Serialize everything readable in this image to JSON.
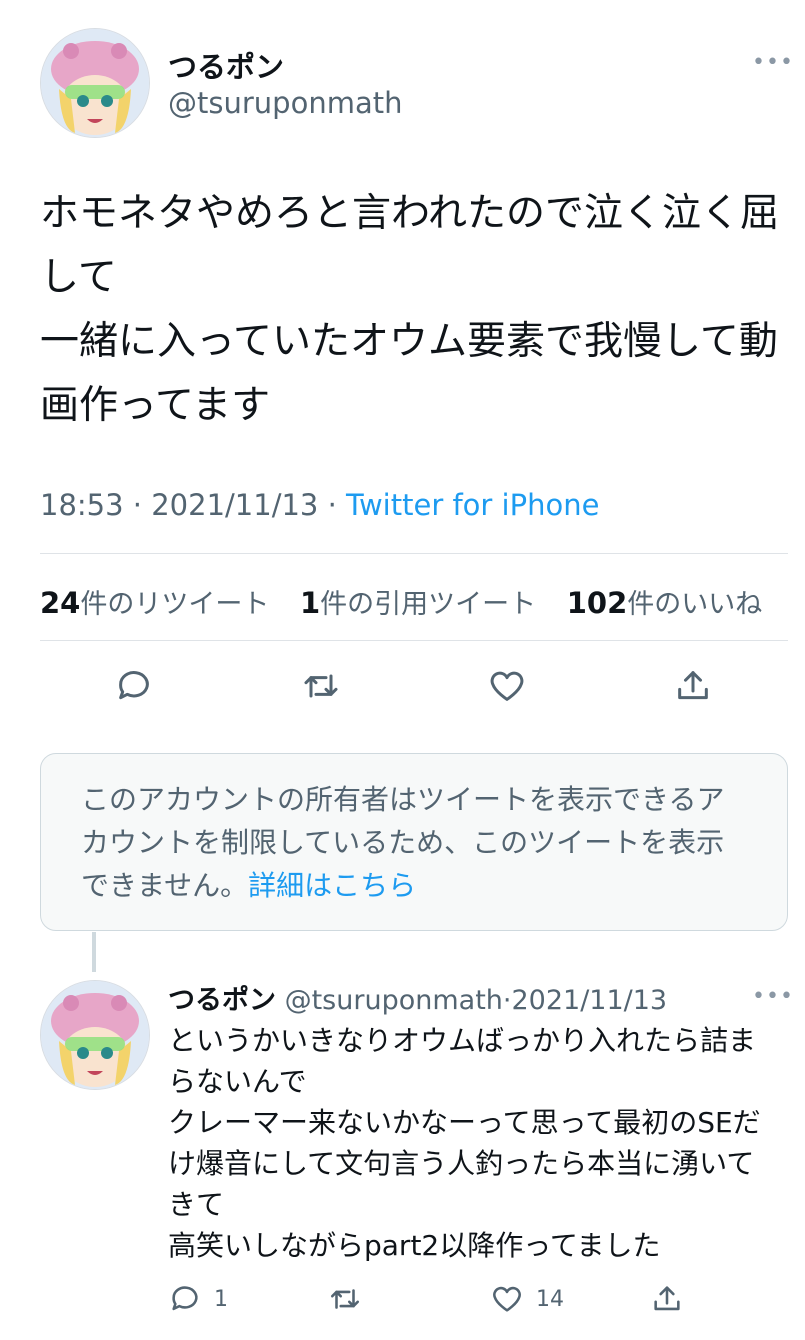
{
  "tweet": {
    "author_name": "つるポン",
    "author_handle": "@tsuruponmath",
    "more_icon": "more-horizontal-icon",
    "text": "ホモネタやめろと言われたので泣く泣く屈して\n一緒に入っていたオウム要素で我慢して動画作ってます",
    "time": "18:53",
    "date": "2021/11/13",
    "separator": " · ",
    "source": "Twitter for iPhone",
    "stats": {
      "retweets_count": "24",
      "retweets_label": "件のリツイート",
      "quotes_count": "1",
      "quotes_label": "件の引用ツイート",
      "likes_count": "102",
      "likes_label": "件のいいね"
    },
    "actions": [
      "reply-icon",
      "retweet-icon",
      "like-icon",
      "share-icon"
    ]
  },
  "notice": {
    "text": "このアカウントの所有者はツイートを表示できるアカウントを制限しているため、このツイートを表示できません。",
    "link_text": "詳細はこちら"
  },
  "reply": {
    "author_name": "つるポン",
    "author_handle": "@tsuruponmath",
    "date_sep": "·",
    "date": "2021/11/13",
    "text": "というかいきなりオウムばっかり入れたら詰まらないんで\nクレーマー来ないかなーって思って最初のSEだけ爆音にして文句言う人釣ったら本当に湧いてきて\n高笑いしながらpart2以降作ってました",
    "reply_count": "1",
    "retweet_count": "",
    "like_count": "14"
  },
  "colors": {
    "accent": "#1d9bf0",
    "secondary_text": "#536471",
    "divider": "#dfe3e7"
  }
}
